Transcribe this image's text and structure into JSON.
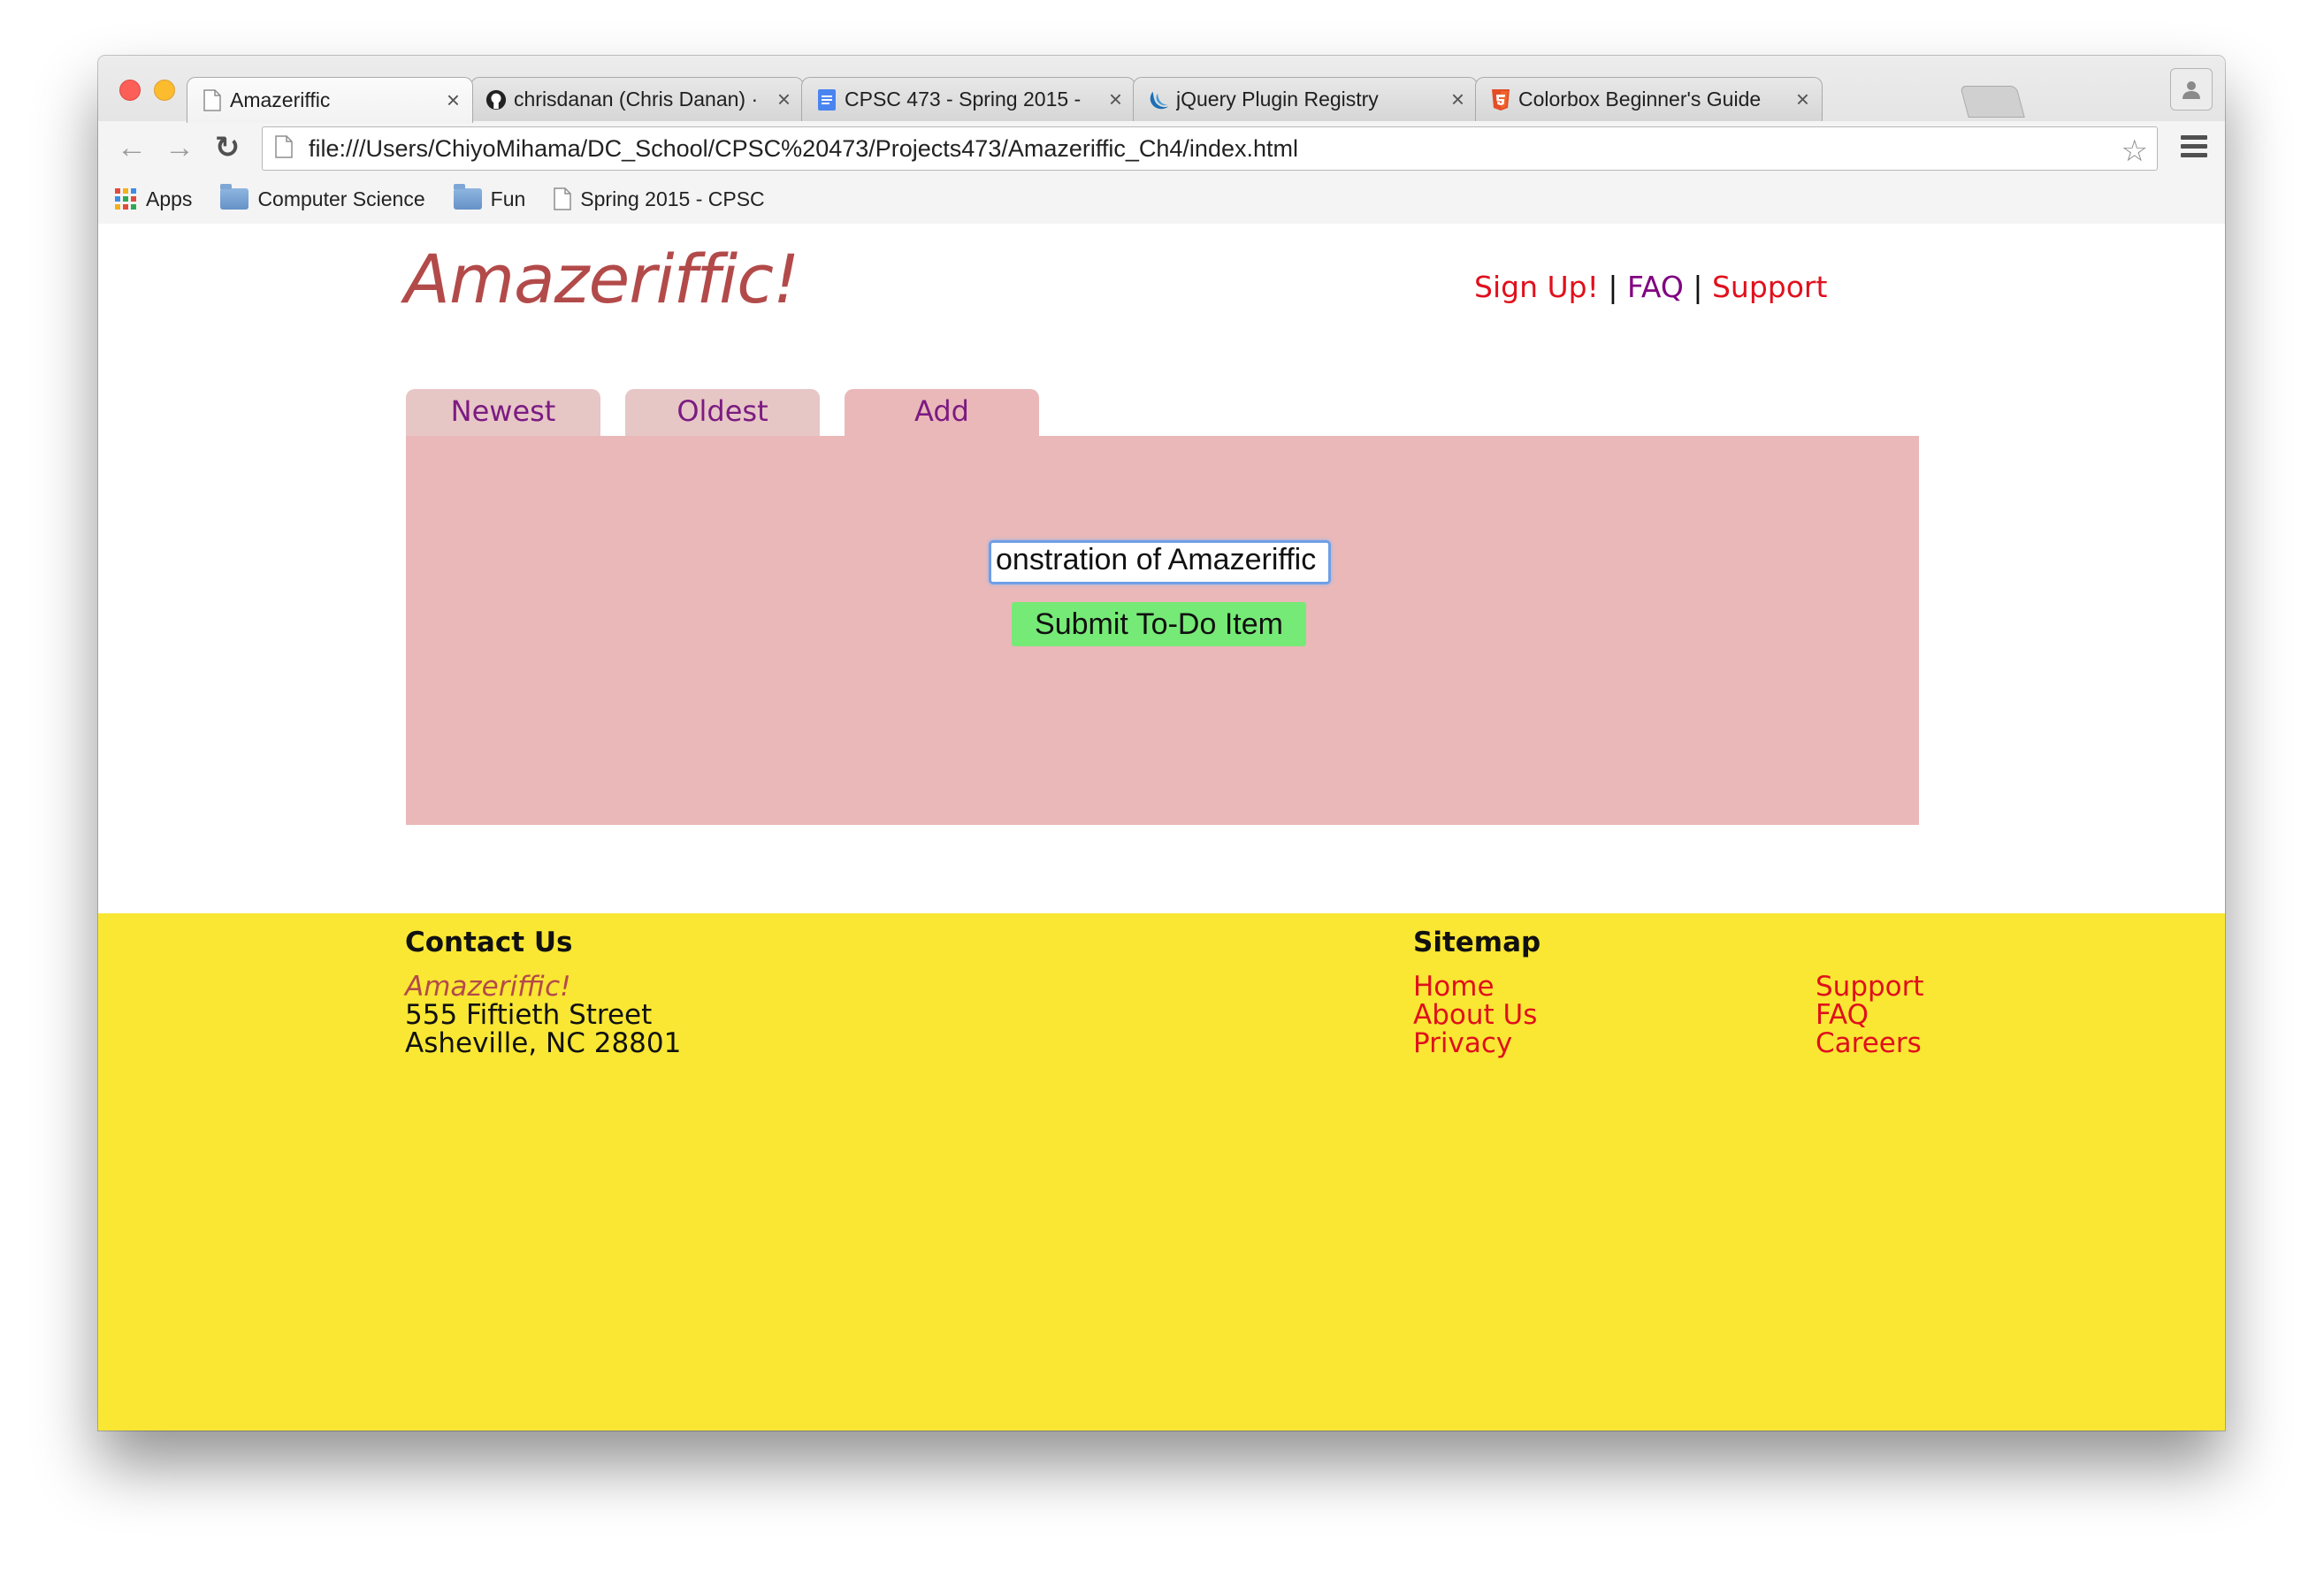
{
  "browser": {
    "tabs": [
      {
        "title": "Amazeriffic",
        "icon": "page-icon",
        "close": "×",
        "active": true
      },
      {
        "title": "chrisdanan (Chris Danan) ·",
        "icon": "github-icon",
        "close": "×",
        "active": false
      },
      {
        "title": "CPSC 473 - Spring 2015 -",
        "icon": "docs-icon",
        "close": "×",
        "active": false
      },
      {
        "title": "jQuery Plugin Registry",
        "icon": "jquery-icon",
        "close": "×",
        "active": false
      },
      {
        "title": "Colorbox Beginner's Guide",
        "icon": "html5-icon",
        "close": "×",
        "active": false
      }
    ],
    "url": "file:///Users/ChiyoMihama/DC_School/CPSC%20473/Projects473/Amazeriffic_Ch4/index.html",
    "nav": {
      "back": "←",
      "forward": "→",
      "reload": "↻",
      "star": "☆"
    },
    "bookmarks": [
      {
        "label": "Apps",
        "icon": "apps-grid-icon"
      },
      {
        "label": "Computer Science",
        "icon": "folder-icon"
      },
      {
        "label": "Fun",
        "icon": "folder-icon"
      },
      {
        "label": "Spring 2015 - CPSC",
        "icon": "page-icon"
      }
    ]
  },
  "page": {
    "logo": "Amazeriffic!",
    "topnav": {
      "signup": "Sign Up!",
      "sep1": "|",
      "faq": "FAQ",
      "sep2": "|",
      "support": "Support"
    },
    "tabs": [
      "Newest",
      "Oldest",
      "Add"
    ],
    "active_tab": "Add",
    "form": {
      "input_value": "onstration of Amazeriffic",
      "submit_label": "Submit To-Do Item"
    },
    "footer": {
      "contact": {
        "heading": "Contact Us",
        "brand": "Amazeriffic!",
        "street": "555 Fiftieth Street",
        "city": "Asheville, NC 28801"
      },
      "sitemap": {
        "heading": "Sitemap",
        "col1": [
          "Home",
          "About Us",
          "Privacy"
        ],
        "col2": [
          "Support",
          "FAQ",
          "Careers"
        ]
      }
    }
  },
  "colors": {
    "logo": "#b34a4a",
    "link_red": "#e0101c",
    "link_visited": "#800080",
    "panel": "#eab8b8",
    "tab_inactive": "#e7c6c6",
    "submit_button": "#76ea76",
    "footer": "#f9e733"
  }
}
